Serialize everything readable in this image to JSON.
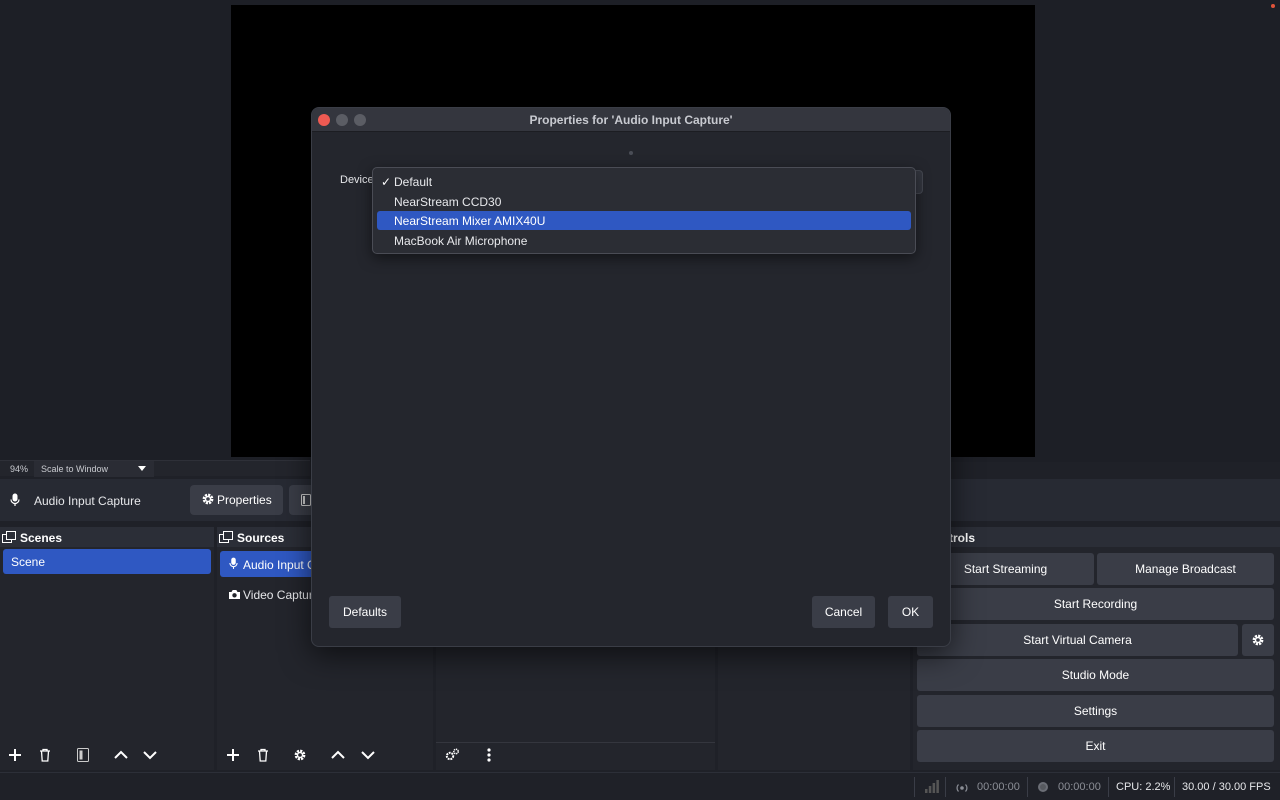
{
  "preview": {
    "zoom_percent": "94%",
    "zoom_mode": "Scale to Window"
  },
  "context_bar": {
    "source_name": "Audio Input Capture",
    "properties_label": "Properties"
  },
  "scenes": {
    "title": "Scenes",
    "items": [
      "Scene"
    ]
  },
  "sources": {
    "title": "Sources",
    "items": [
      "Audio Input C",
      "Video Capture"
    ]
  },
  "controls": {
    "title": "trols",
    "start_streaming": "Start Streaming",
    "manage_broadcast": "Manage Broadcast",
    "start_recording": "Start Recording",
    "start_virtual_camera": "Start Virtual Camera",
    "studio_mode": "Studio Mode",
    "settings": "Settings",
    "exit": "Exit"
  },
  "status": {
    "stream_time": "00:00:00",
    "record_time": "00:00:00",
    "cpu": "CPU: 2.2%",
    "fps": "30.00 / 30.00 FPS"
  },
  "modal": {
    "title": "Properties for 'Audio Input Capture'",
    "device_label": "Device",
    "selected_check": "✓",
    "options": [
      "Default",
      "NearStream CCD30",
      "NearStream Mixer AMIX40U",
      "MacBook Air Microphone"
    ],
    "highlighted_index": 2,
    "defaults_label": "Defaults",
    "cancel_label": "Cancel",
    "ok_label": "OK"
  },
  "colors": {
    "accent": "#2f58c2",
    "close_light": "#ee5a52",
    "inactive_light": "#5b5d64"
  }
}
